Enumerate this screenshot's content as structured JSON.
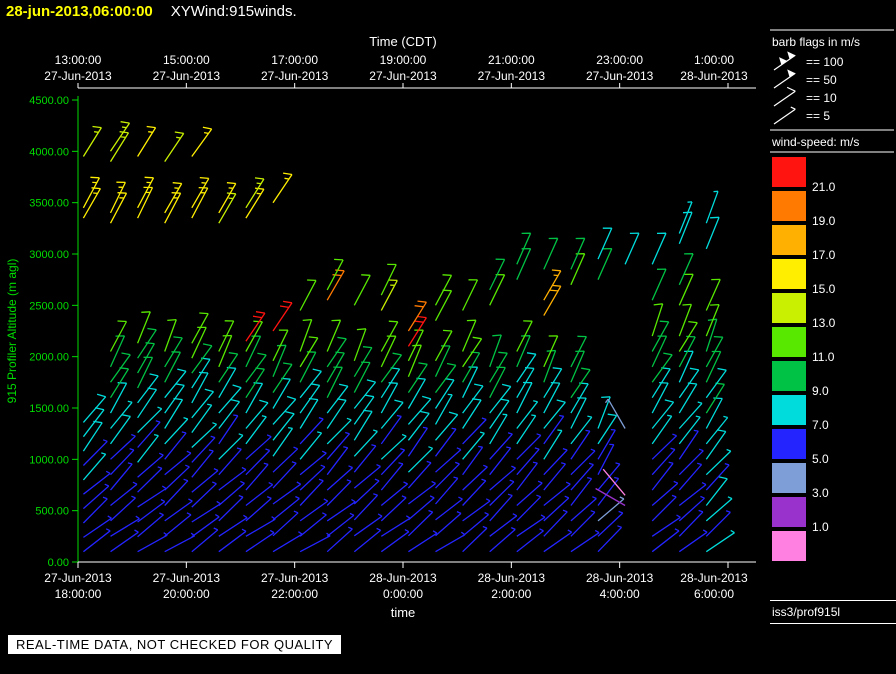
{
  "title": {
    "timestamp": "28-jun-2013,06:00:00",
    "app": "XYWind:915winds."
  },
  "footer": {
    "notice": "REAL-TIME DATA, NOT CHECKED FOR QUALITY",
    "station": "iss3/prof915l"
  },
  "chart_data": {
    "type": "wind-barb-time-height",
    "top_axis": {
      "title": "Time (CDT)",
      "ticks": [
        {
          "time": "13:00:00",
          "date": "27-Jun-2013"
        },
        {
          "time": "15:00:00",
          "date": "27-Jun-2013"
        },
        {
          "time": "17:00:00",
          "date": "27-Jun-2013"
        },
        {
          "time": "19:00:00",
          "date": "27-Jun-2013"
        },
        {
          "time": "21:00:00",
          "date": "27-Jun-2013"
        },
        {
          "time": "23:00:00",
          "date": "27-Jun-2013"
        },
        {
          "time": "1:00:00",
          "date": "28-Jun-2013"
        }
      ]
    },
    "bottom_axis": {
      "title": "time",
      "ticks": [
        {
          "date": "27-Jun-2013",
          "time": "18:00:00"
        },
        {
          "date": "27-Jun-2013",
          "time": "20:00:00"
        },
        {
          "date": "27-Jun-2013",
          "time": "22:00:00"
        },
        {
          "date": "28-Jun-2013",
          "time": "0:00:00"
        },
        {
          "date": "28-Jun-2013",
          "time": "2:00:00"
        },
        {
          "date": "28-Jun-2013",
          "time": "4:00:00"
        },
        {
          "date": "28-Jun-2013",
          "time": "6:00:00"
        }
      ]
    },
    "y_axis": {
      "title": "915 Profiler Altitude (m agl)",
      "ticks": [
        "0.00",
        "500.00",
        "1000.00",
        "1500.00",
        "2000.00",
        "2500.00",
        "3000.00",
        "3500.00",
        "4000.00",
        "4500.00"
      ],
      "min": 0,
      "max": 4500
    },
    "x_hours_utc": [
      18,
      30
    ],
    "barb_legend": {
      "title": "barb flags in m/s",
      "items": [
        {
          "glyph": "flag-100",
          "label": "== 100"
        },
        {
          "glyph": "flag-50",
          "label": "== 50"
        },
        {
          "glyph": "barb-10",
          "label": "== 10"
        },
        {
          "glyph": "half-barb-5",
          "label": "== 5"
        }
      ]
    },
    "colorbar": {
      "title": "wind-speed: m/s",
      "labels": [
        "21.0",
        "19.0",
        "17.0",
        "15.0",
        "13.0",
        "11.0",
        "9.0",
        "7.0",
        "5.0",
        "3.0",
        "1.0"
      ],
      "colors": [
        "#ff1410",
        "#ff7a00",
        "#ffb000",
        "#ffee00",
        "#c8f000",
        "#58e800",
        "#00c244",
        "#00dcdc",
        "#2424ff",
        "#7d9ed6",
        "#9932cc",
        "#ff80e0"
      ]
    },
    "profiles": [
      {
        "t": 18.1,
        "n": 10,
        "a0": 100,
        "da": 140,
        "s0": 6,
        "s1": 9,
        "d0": 235,
        "d1": 215,
        "extra": [
          [
            3350,
            15,
            210
          ],
          [
            3450,
            15,
            208
          ],
          [
            3950,
            14,
            212
          ]
        ]
      },
      {
        "t": 18.6,
        "n": 14,
        "a0": 100,
        "da": 150,
        "s0": 6,
        "s1": 12,
        "d0": 235,
        "d1": 205,
        "extra": [
          [
            3300,
            15,
            208
          ],
          [
            3400,
            16,
            206
          ],
          [
            3900,
            14,
            212
          ],
          [
            4000,
            14,
            214
          ]
        ]
      },
      {
        "t": 19.1,
        "n": 15,
        "a0": 100,
        "da": 145,
        "s0": 6,
        "s1": 12,
        "d0": 238,
        "d1": 205,
        "extra": [
          [
            3350,
            16,
            206
          ],
          [
            3450,
            15,
            208
          ],
          [
            3950,
            15,
            212
          ]
        ]
      },
      {
        "t": 19.6,
        "n": 14,
        "a0": 100,
        "da": 150,
        "s0": 6,
        "s1": 11,
        "d0": 236,
        "d1": 206,
        "extra": [
          [
            3300,
            15,
            208
          ],
          [
            3400,
            15,
            210
          ],
          [
            3900,
            14,
            214
          ]
        ]
      },
      {
        "t": 20.1,
        "n": 15,
        "a0": 100,
        "da": 145,
        "s0": 6,
        "s1": 12,
        "d0": 236,
        "d1": 206,
        "extra": [
          [
            3350,
            16,
            208
          ],
          [
            3450,
            15,
            210
          ],
          [
            3950,
            15,
            216
          ]
        ]
      },
      {
        "t": 20.6,
        "n": 14,
        "a0": 100,
        "da": 150,
        "s0": 6,
        "s1": 12,
        "d0": 236,
        "d1": 206,
        "extra": [
          [
            3300,
            14,
            210
          ],
          [
            3400,
            15,
            210
          ]
        ]
      },
      {
        "t": 21.1,
        "n": 14,
        "a0": 100,
        "da": 150,
        "s0": 6,
        "s1": 12,
        "d0": 236,
        "d1": 206,
        "extra": [
          [
            2150,
            21,
            214
          ],
          [
            3350,
            15,
            212
          ],
          [
            3450,
            14,
            212
          ]
        ]
      },
      {
        "t": 21.6,
        "n": 13,
        "a0": 100,
        "da": 155,
        "s0": 6,
        "s1": 12,
        "d0": 236,
        "d1": 206,
        "extra": [
          [
            2250,
            21,
            214
          ],
          [
            3500,
            15,
            214
          ]
        ]
      },
      {
        "t": 22.1,
        "n": 14,
        "a0": 100,
        "da": 150,
        "s0": 6,
        "s1": 12,
        "d0": 236,
        "d1": 206,
        "extra": [
          [
            2450,
            12,
            208
          ]
        ]
      },
      {
        "t": 22.6,
        "n": 14,
        "a0": 100,
        "da": 150,
        "s0": 6,
        "s1": 12,
        "d0": 234,
        "d1": 206,
        "extra": [
          [
            2550,
            20,
            210
          ],
          [
            2650,
            11,
            208
          ]
        ]
      },
      {
        "t": 23.1,
        "n": 13,
        "a0": 100,
        "da": 155,
        "s0": 6,
        "s1": 12,
        "d0": 234,
        "d1": 206,
        "extra": [
          [
            2500,
            12,
            208
          ]
        ]
      },
      {
        "t": 23.6,
        "n": 14,
        "a0": 100,
        "da": 150,
        "s0": 6,
        "s1": 12,
        "d0": 234,
        "d1": 206,
        "extra": [
          [
            2450,
            13,
            208
          ],
          [
            2600,
            12,
            206
          ]
        ]
      },
      {
        "t": 24.1,
        "n": 13,
        "a0": 100,
        "da": 155,
        "s0": 6,
        "s1": 12,
        "d0": 234,
        "d1": 206,
        "extra": [
          [
            2100,
            21,
            212
          ],
          [
            2250,
            20,
            212
          ]
        ]
      },
      {
        "t": 24.6,
        "n": 13,
        "a0": 100,
        "da": 155,
        "s0": 6,
        "s1": 11,
        "d0": 234,
        "d1": 206,
        "extra": [
          [
            2350,
            12,
            208
          ],
          [
            2500,
            11,
            208
          ]
        ]
      },
      {
        "t": 25.1,
        "n": 14,
        "a0": 100,
        "da": 150,
        "s0": 6,
        "s1": 12,
        "d0": 232,
        "d1": 206,
        "extra": [
          [
            2450,
            12,
            206
          ]
        ]
      },
      {
        "t": 25.6,
        "n": 13,
        "a0": 100,
        "da": 150,
        "s0": 6,
        "s1": 11,
        "d0": 232,
        "d1": 206,
        "extra": [
          [
            2500,
            11,
            206
          ],
          [
            2650,
            10,
            206
          ]
        ]
      },
      {
        "t": 26.1,
        "n": 14,
        "a0": 100,
        "da": 150,
        "s0": 6,
        "s1": 11,
        "d0": 232,
        "d1": 204,
        "extra": [
          [
            2750,
            10,
            204
          ],
          [
            2900,
            9,
            204
          ]
        ]
      },
      {
        "t": 26.6,
        "n": 13,
        "a0": 100,
        "da": 150,
        "s0": 6,
        "s1": 11,
        "d0": 232,
        "d1": 204,
        "extra": [
          [
            2400,
            18,
            210
          ],
          [
            2550,
            17,
            210
          ],
          [
            2850,
            10,
            204
          ]
        ]
      },
      {
        "t": 27.1,
        "n": 13,
        "a0": 100,
        "da": 150,
        "s0": 6,
        "s1": 11,
        "d0": 230,
        "d1": 204,
        "extra": [
          [
            2700,
            11,
            204
          ],
          [
            2850,
            10,
            204
          ]
        ]
      },
      {
        "t": 27.6,
        "n": 9,
        "a0": 100,
        "da": 150,
        "s0": 5,
        "s1": 9,
        "d0": 230,
        "d1": 204,
        "extra": [
          [
            2750,
            9,
            204
          ],
          [
            2950,
            8,
            204
          ]
        ]
      },
      {
        "t": 28.1,
        "n": 0,
        "a0": 100,
        "da": 150,
        "s0": 0,
        "s1": 0,
        "d0": 230,
        "d1": 204,
        "extra": [
          [
            550,
            2,
            120
          ],
          [
            650,
            0.8,
            140
          ],
          [
            1300,
            4,
            150
          ],
          [
            2900,
            8,
            204
          ]
        ]
      },
      {
        "t": 28.6,
        "n": 15,
        "a0": 100,
        "da": 150,
        "s0": 6,
        "s1": 12,
        "d0": 232,
        "d1": 204,
        "extra": [
          [
            2550,
            10,
            204
          ],
          [
            2900,
            8,
            204
          ]
        ]
      },
      {
        "t": 29.1,
        "n": 15,
        "a0": 100,
        "da": 150,
        "s0": 6,
        "s1": 12,
        "d0": 232,
        "d1": 204,
        "extra": [
          [
            2500,
            11,
            204
          ],
          [
            2700,
            10,
            204
          ],
          [
            3100,
            8,
            202
          ],
          [
            3200,
            7,
            202
          ]
        ]
      },
      {
        "t": 29.6,
        "n": 15,
        "a0": 100,
        "da": 150,
        "s0": 7,
        "s1": 12,
        "d0": 230,
        "d1": 202,
        "extra": [
          [
            2450,
            12,
            204
          ],
          [
            3050,
            8,
            202
          ],
          [
            3300,
            7,
            200
          ]
        ]
      }
    ]
  }
}
